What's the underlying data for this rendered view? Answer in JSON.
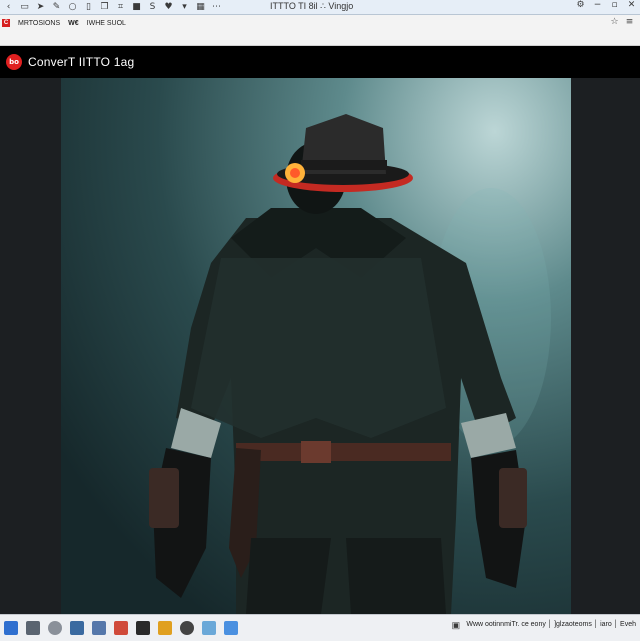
{
  "window": {
    "title": "ITTTO TI 8il ∴ Vingjo"
  },
  "bookmarks": {
    "items": [
      "MRTOSIONS",
      "W€",
      "IWHE SUOL"
    ],
    "tab_label": "ooooe"
  },
  "app": {
    "title": "ConverT IITTO 1ag"
  },
  "statusbar": {
    "text": "Www ootinnmiTr. ce eony │ ]glzaoteoms │ iaro │ Eveh"
  },
  "colors": {
    "accent": "#e02020",
    "titlebar": "#e6eef7",
    "header": "#000000"
  }
}
